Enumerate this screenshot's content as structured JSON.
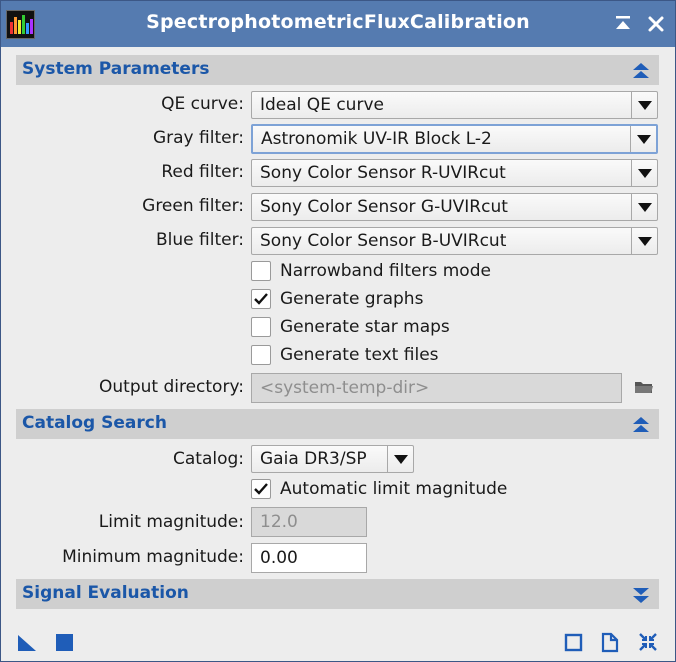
{
  "window": {
    "title": "SpectrophotometricFluxCalibration"
  },
  "system": {
    "header": "System Parameters",
    "qe_label": "QE curve:",
    "qe_value": "Ideal QE curve",
    "gray_label": "Gray filter:",
    "gray_value": "Astronomik UV-IR Block L-2",
    "red_label": "Red filter:",
    "red_value": "Sony Color Sensor R-UVIRcut",
    "green_label": "Green filter:",
    "green_value": "Sony Color Sensor G-UVIRcut",
    "blue_label": "Blue filter:",
    "blue_value": "Sony Color Sensor B-UVIRcut",
    "narrowband_label": "Narrowband filters mode",
    "graphs_label": "Generate graphs",
    "starmaps_label": "Generate star maps",
    "textfiles_label": "Generate text files",
    "output_label": "Output directory:",
    "output_placeholder": "<system-temp-dir>"
  },
  "catalog": {
    "header": "Catalog Search",
    "catalog_label": "Catalog:",
    "catalog_value": "Gaia DR3/SP",
    "auto_limit_label": "Automatic limit magnitude",
    "limit_label": "Limit magnitude:",
    "limit_placeholder": "12.0",
    "min_label": "Minimum magnitude:",
    "min_value": "0.00"
  },
  "signal": {
    "header": "Signal Evaluation"
  },
  "icons": {
    "app": "app-icon",
    "shade": "shade-icon",
    "close": "close-icon",
    "collapse": "collapse-icon",
    "expand": "expand-icon",
    "folder": "folder-icon",
    "new_instance": "new-instance-icon",
    "apply_global": "apply-global-icon",
    "browse_doc": "documentation-icon",
    "reset": "reset-icon",
    "preview": "preview-icon"
  },
  "colors": {
    "titlebar": "#557bb0",
    "section_label": "#1b57a8",
    "icon_blue": "#1f5db8"
  }
}
